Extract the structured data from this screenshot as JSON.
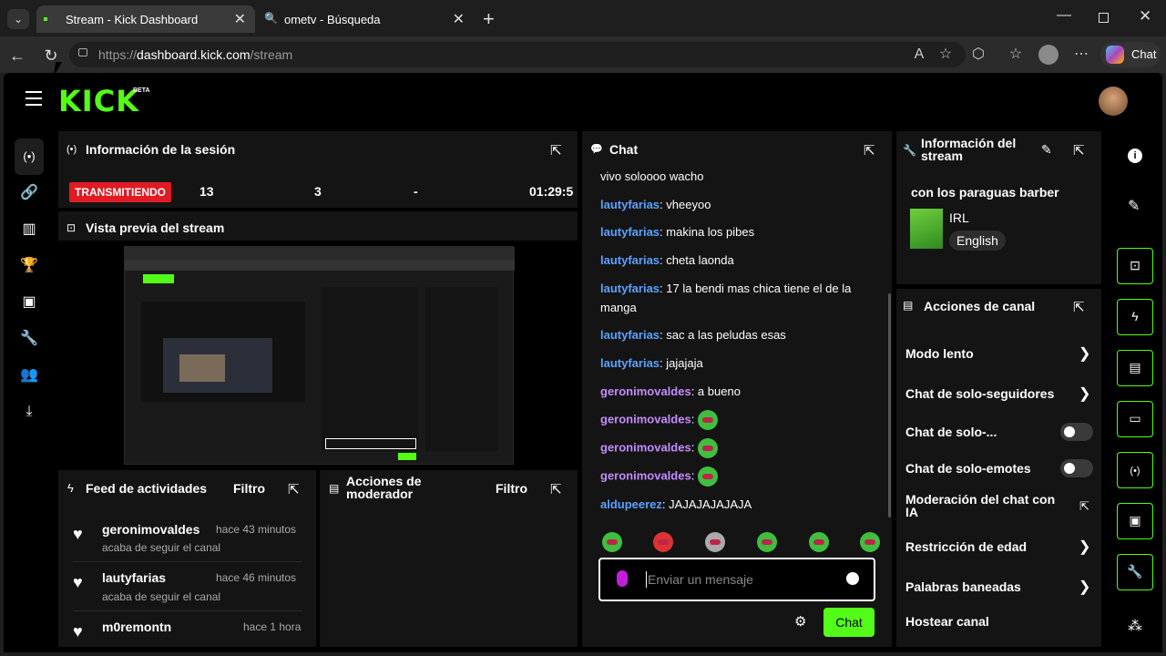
{
  "browser": {
    "tabs": [
      {
        "title": "Stream - Kick Dashboard",
        "active": true
      },
      {
        "title": "ometv - Búsqueda",
        "active": false
      }
    ],
    "url_prefix": "https://",
    "url_domain": "dashboard.kick.com",
    "url_path": "/stream",
    "copilot_label": "Chat"
  },
  "app": {
    "logo": "KICK",
    "beta": "BETA"
  },
  "session": {
    "title": "Información de la sesión",
    "status": "TRANSMITIENDO",
    "stat1": "13",
    "stat2": "3",
    "stat3": "-",
    "time": "01:29:5"
  },
  "preview": {
    "title": "Vista previa del stream"
  },
  "feed": {
    "title": "Feed de actividades",
    "filter": "Filtro",
    "items": [
      {
        "user": "geronimovaldes",
        "time": "hace 43 minutos",
        "action": "acaba de seguir el canal"
      },
      {
        "user": "lautyfarias",
        "time": "hace 46 minutos",
        "action": "acaba de seguir el canal"
      },
      {
        "user": "m0remontn",
        "time": "hace 1 hora",
        "action": ""
      }
    ]
  },
  "moderator": {
    "title": "Acciones de moderador",
    "filter": "Filtro"
  },
  "chat": {
    "title": "Chat",
    "messages": [
      {
        "user": "",
        "text": "vivo soloooo wacho"
      },
      {
        "user": "lautyfarias",
        "text": ": vheeyoo"
      },
      {
        "user": "lautyfarias",
        "text": ": makina los pibes"
      },
      {
        "user": "lautyfarias",
        "text": ": cheta laonda"
      },
      {
        "user": "lautyfarias",
        "text": ": 17 la bendi mas chica tiene el de la"
      },
      {
        "user": "",
        "text": "manga"
      },
      {
        "user": "lautyfarias",
        "text": ": sac a las peludas esas"
      },
      {
        "user": "lautyfarias",
        "text": ": jajajaja"
      },
      {
        "user": "geronimovaldes",
        "text": ": a bueno"
      },
      {
        "user": "geronimovaldes",
        "text": ":"
      },
      {
        "user": "geronimovaldes",
        "text": ":"
      },
      {
        "user": "geronimovaldes",
        "text": ":"
      },
      {
        "user": "aldupeerez",
        "text": ": JAJAJAJAJAJA"
      }
    ],
    "input_placeholder": "Enviar un mensaje",
    "send_label": "Chat"
  },
  "stream_info": {
    "title_line1": "Información del",
    "title_line2": "stream",
    "stream_title": "con los paraguas barber",
    "category": "IRL",
    "language": "English"
  },
  "channel_actions": {
    "title": "Acciones de canal",
    "items": [
      {
        "label": "Modo lento",
        "control": "chevron"
      },
      {
        "label": "Chat de solo-seguidores",
        "control": "chevron"
      },
      {
        "label": "Chat de solo-...",
        "control": "toggle"
      },
      {
        "label": "Chat de solo-emotes",
        "control": "toggle"
      },
      {
        "label_line1": "Moderación del chat con",
        "label_line2": "IA",
        "control": "external"
      },
      {
        "label": "Restricción de edad",
        "control": "chevron"
      },
      {
        "label": "Palabras baneadas",
        "control": "chevron"
      },
      {
        "label": "Hostear canal",
        "control": "none"
      }
    ]
  },
  "colors": {
    "accent": "#53fc18",
    "live": "#e01b24",
    "panel": "#141414"
  }
}
